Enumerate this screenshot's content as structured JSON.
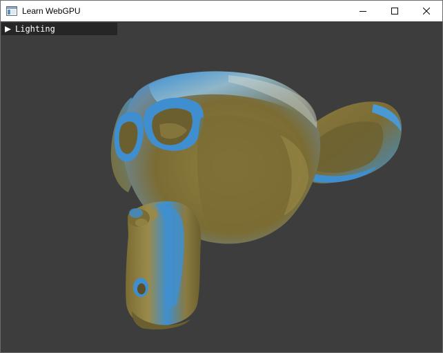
{
  "window": {
    "title": "Learn WebGPU",
    "icon": "app-window-icon",
    "controls": [
      "minimize-icon",
      "maximize-icon",
      "close-icon"
    ]
  },
  "gui": {
    "panel_label": "Lighting",
    "collapsed": true,
    "arrow_icon": "triangle-right-icon"
  },
  "scene": {
    "model": "suzanne-monkey-head",
    "background_color": "#3d3d3d",
    "base_color": "#8b7a3a",
    "highlight_color": "#3f8fd0"
  }
}
